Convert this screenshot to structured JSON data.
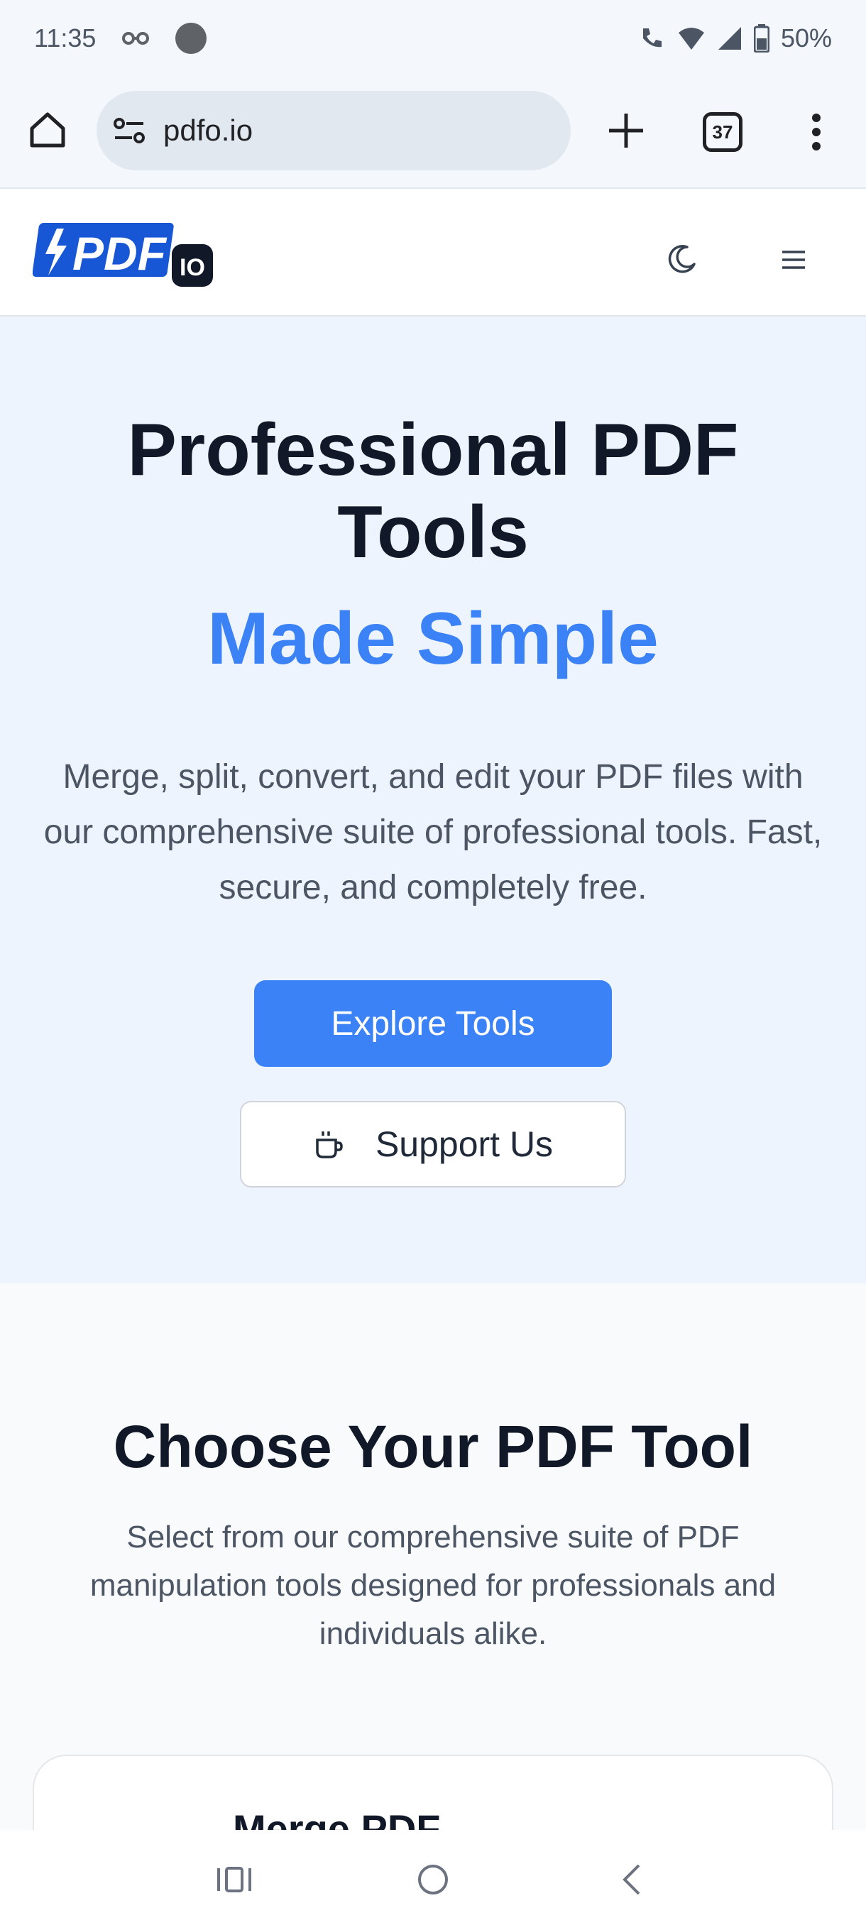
{
  "status_bar": {
    "time": "11:35",
    "battery": "50%"
  },
  "browser": {
    "url": "pdfo.io",
    "tab_count": "37"
  },
  "header": {
    "logo_text": "PDF",
    "logo_badge": "IO"
  },
  "hero": {
    "title": "Professional PDF Tools",
    "highlight": "Made Simple",
    "description": "Merge, split, convert, and edit your PDF files with our comprehensive suite of professional tools. Fast, secure, and completely free.",
    "primary_button": "Explore Tools",
    "secondary_button": "Support Us"
  },
  "tools": {
    "title": "Choose Your PDF Tool",
    "description": "Select from our comprehensive suite of PDF manipulation tools designed for professionals and individuals alike.",
    "first_card_title": "Merge PDF"
  },
  "colors": {
    "accent": "#3b82f6",
    "hero_bg": "#eef4fd",
    "logo_blue": "#1757d6"
  },
  "icons": {
    "home": "home-icon",
    "site_settings": "site-settings-icon",
    "new_tab": "plus-icon",
    "more": "more-vert-icon",
    "theme": "moon-icon",
    "menu": "hamburger-icon",
    "support": "coffee-cup-icon"
  }
}
